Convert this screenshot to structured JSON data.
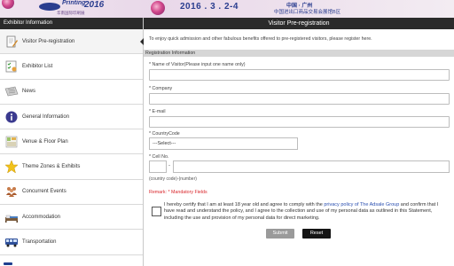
{
  "banner": {
    "brand_title": "Printing",
    "brand_year": "2016",
    "brand_subtitle": "华南国际印刷展",
    "event_date": "2016 . 3 . 2-4",
    "event_city": "中国 · 广州",
    "event_venue": "中国进出口商品交易会展馆B区"
  },
  "sidebar": {
    "header": "Exhibitor Information",
    "items": [
      {
        "label": "Visitor Pre-registration",
        "icon": "document-pen-icon"
      },
      {
        "label": "Exhibitor List",
        "icon": "checklist-icon"
      },
      {
        "label": "News",
        "icon": "newspaper-icon"
      },
      {
        "label": "General Information",
        "icon": "info-icon"
      },
      {
        "label": "Venue & Floor Plan",
        "icon": "floor-plan-icon"
      },
      {
        "label": "Theme Zones & Exhibits",
        "icon": "star-icon"
      },
      {
        "label": "Concurrent Events",
        "icon": "people-icon"
      },
      {
        "label": "Accommodation",
        "icon": "bed-icon"
      },
      {
        "label": "Transportation",
        "icon": "bus-icon"
      }
    ]
  },
  "main": {
    "header": "Visitor Pre-registration",
    "intro": "To enjoy quick admission and other fabulous benefits offered to pre-registered visitors, please register here.",
    "section_title": "Registration Information",
    "fields": {
      "name_label": "* Name of Visitor(Please input one name only)",
      "name_value": "",
      "company_label": "* Company",
      "company_value": "",
      "email_label": "* E-mail",
      "email_value": "",
      "country_label": "* CountryCode",
      "country_selected": "---Select---",
      "cell_label": "* Cell No.",
      "cell_code_value": "",
      "cell_dash": "-",
      "cell_number_value": "",
      "cell_hint": "(country code)-(number)"
    },
    "remark": "Remark: * Mandatory Fields",
    "consent_before": "I hereby certify that I am at least 18 year old and agree to comply with the ",
    "consent_link": "privacy policy of The Adsale Group",
    "consent_after": " and confirm that I have read and understand the policy, and I agree to the collection and use of my personal data as outlined in this Statement, including the use and provision of my personal data for direct marketing.",
    "consent_checked": false,
    "submit_label": "Submit",
    "reset_label": "Reset"
  },
  "colors": {
    "header_bg": "#2b2b2b",
    "section_bg": "#d6d6d6",
    "remark": "#d9262b",
    "link": "#2a4fb0",
    "submit_bg": "#9a9a9a",
    "reset_bg": "#151515",
    "brand": "#2a3d8f"
  }
}
